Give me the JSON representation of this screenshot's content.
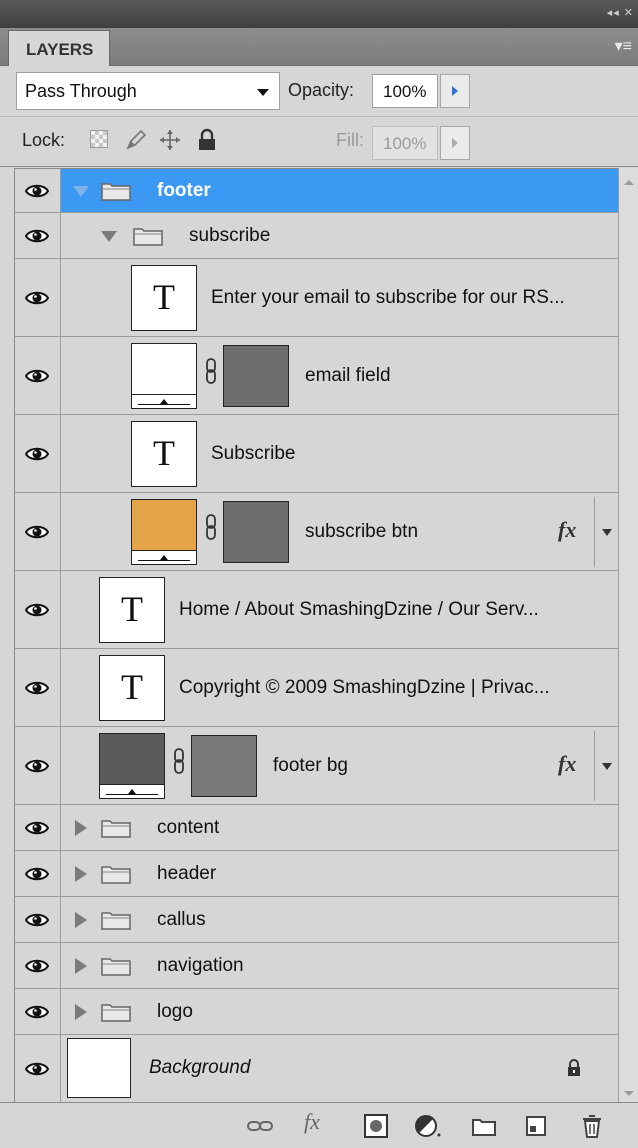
{
  "panel": {
    "tab_label": "LAYERS",
    "title_controls": "◂◂ ✕",
    "menu_icon": "panel-menu-icon"
  },
  "blend": {
    "mode": "Pass Through",
    "opacity_label": "Opacity:",
    "opacity_value": "100%",
    "lock_label": "Lock:",
    "fill_label": "Fill:",
    "fill_value": "100%"
  },
  "layers": [
    {
      "name": "footer",
      "kind": "group",
      "expanded": true,
      "selected": true,
      "visible": true
    },
    {
      "name": "subscribe",
      "kind": "group",
      "expanded": true,
      "visible": true
    },
    {
      "name": "Enter your email to subscribe for our RS...",
      "kind": "text",
      "visible": true
    },
    {
      "name": "email field",
      "kind": "shape",
      "fill_color": "#ffffff",
      "mask_color": "#6e6e6e",
      "visible": true
    },
    {
      "name": "Subscribe",
      "kind": "text",
      "visible": true
    },
    {
      "name": "subscribe btn",
      "kind": "shape",
      "fill_color": "#e4a549",
      "mask_color": "#6e6e6e",
      "has_fx": true,
      "visible": true
    },
    {
      "name": "Home  /  About SmashingDzine  /  Our Serv...",
      "kind": "text",
      "visible": true
    },
    {
      "name": "Copyright © 2009 SmashingDzine  |  Privac...",
      "kind": "text",
      "visible": true
    },
    {
      "name": "footer bg",
      "kind": "shape",
      "fill_color": "#5b5b5b",
      "mask_color": "#7a7a7a",
      "has_fx": true,
      "visible": true
    },
    {
      "name": "content",
      "kind": "group",
      "expanded": false,
      "visible": true
    },
    {
      "name": "header",
      "kind": "group",
      "expanded": false,
      "visible": true
    },
    {
      "name": "callus",
      "kind": "group",
      "expanded": false,
      "visible": true
    },
    {
      "name": "navigation",
      "kind": "group",
      "expanded": false,
      "visible": true
    },
    {
      "name": "logo",
      "kind": "group",
      "expanded": false,
      "visible": true
    },
    {
      "name": "Background",
      "kind": "background",
      "locked": true,
      "visible": true
    }
  ],
  "fx_label": "fx",
  "text_thumb_glyph": "T",
  "colors": {
    "selection": "#3b99f4",
    "panel_bg": "#d6d6d6"
  },
  "footer_icons": [
    "link-layers-icon",
    "fx-icon",
    "add-mask-icon",
    "adjustment-layer-icon",
    "new-group-icon",
    "new-layer-icon",
    "trash-icon"
  ]
}
